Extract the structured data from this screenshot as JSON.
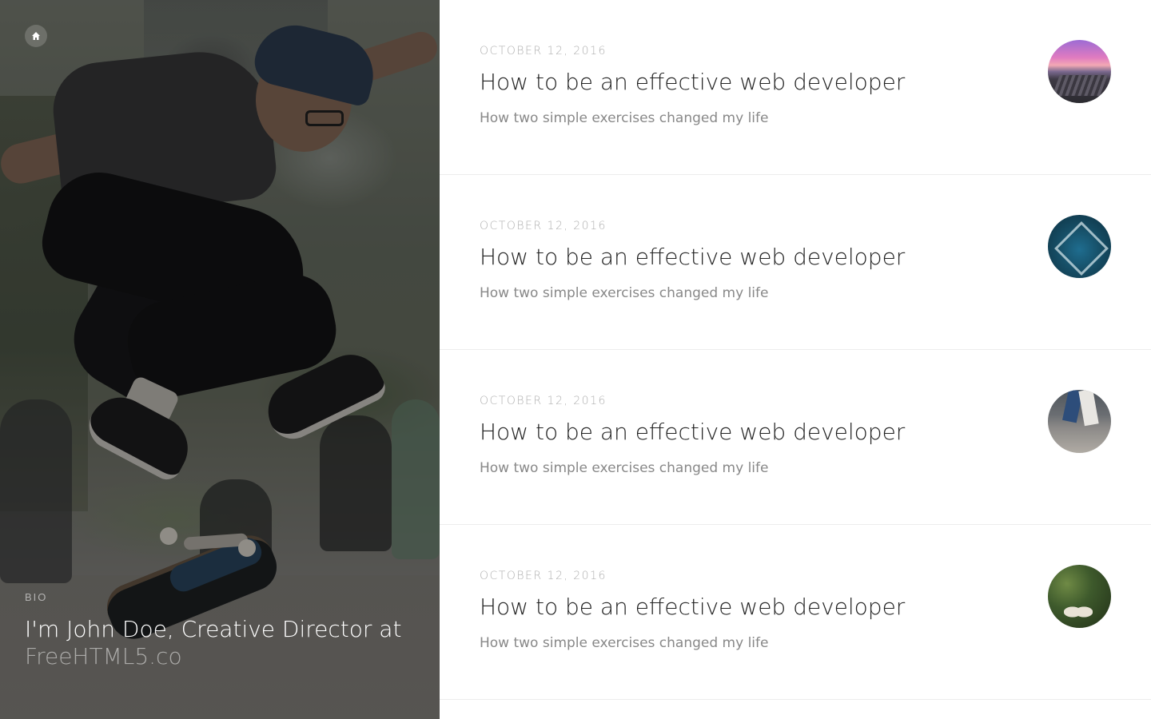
{
  "nav": {
    "home_icon": "home-icon"
  },
  "bio": {
    "label": "BIO",
    "text_prefix": "I'm John Doe, Creative Director at",
    "link_text": "FreeHTML5.co"
  },
  "articles": [
    {
      "date": "OCTOBER 12, 2016",
      "title": "How to be an effective web developer",
      "subtitle": "How two simple exercises changed my life",
      "thumb": "sunset-pier-image"
    },
    {
      "date": "OCTOBER 12, 2016",
      "title": "How to be an effective web developer",
      "subtitle": "How two simple exercises changed my life",
      "thumb": "blue-light-tunnel-image"
    },
    {
      "date": "OCTOBER 12, 2016",
      "title": "How to be an effective web developer",
      "subtitle": "How two simple exercises changed my life",
      "thumb": "people-legs-image"
    },
    {
      "date": "OCTOBER 12, 2016",
      "title": "How to be an effective web developer",
      "subtitle": "How two simple exercises changed my life",
      "thumb": "feet-in-plants-image"
    }
  ],
  "colors": {
    "title": "#222222",
    "subtitle": "#888888",
    "date": "#b0b0b0",
    "divider": "#ececec",
    "bio_link": "rgba(255,255,255,0.5)"
  }
}
